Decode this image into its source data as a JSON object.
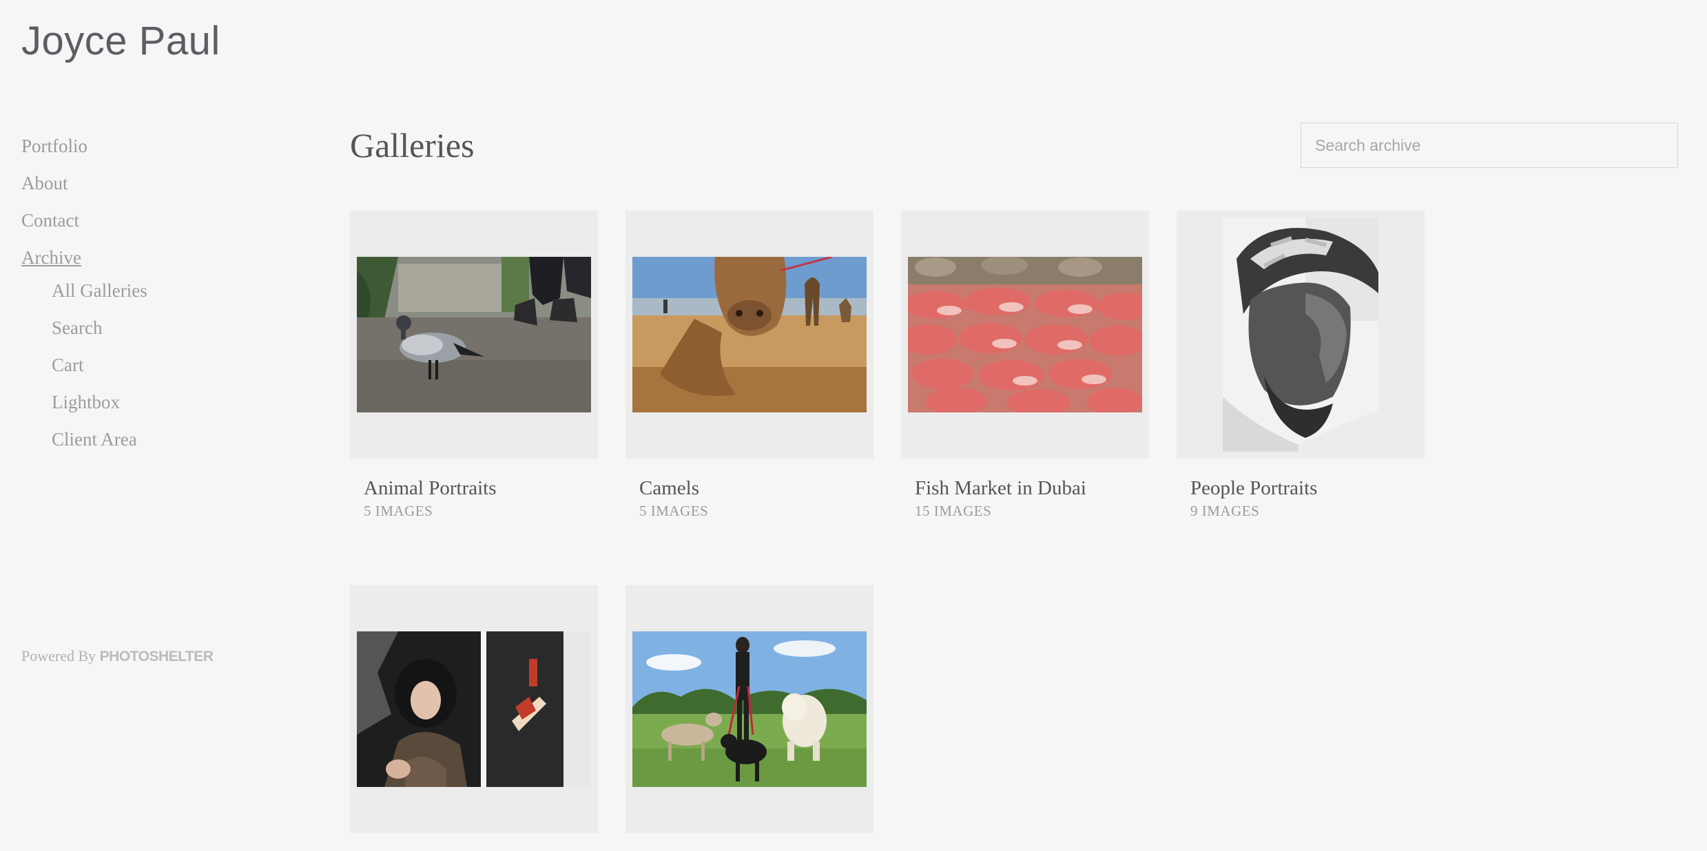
{
  "site": {
    "title": "Joyce Paul"
  },
  "nav": {
    "items": [
      {
        "label": "Portfolio"
      },
      {
        "label": "About"
      },
      {
        "label": "Contact"
      },
      {
        "label": "Archive"
      }
    ],
    "subitems": [
      {
        "label": "All Galleries"
      },
      {
        "label": "Search"
      },
      {
        "label": "Cart"
      },
      {
        "label": "Lightbox"
      },
      {
        "label": "Client Area"
      }
    ]
  },
  "footer": {
    "powered_by": "Powered By",
    "brand": "PHOTOSHELTER"
  },
  "main": {
    "heading": "Galleries",
    "search": {
      "placeholder": "Search archive",
      "value": ""
    }
  },
  "galleries": [
    {
      "title": "Animal Portraits",
      "count": "5 IMAGES"
    },
    {
      "title": "Camels",
      "count": "5 IMAGES"
    },
    {
      "title": "Fish Market in Dubai",
      "count": "15 IMAGES"
    },
    {
      "title": "People Portraits",
      "count": "9 IMAGES"
    },
    {
      "title": "",
      "count": ""
    },
    {
      "title": "",
      "count": ""
    }
  ],
  "colors": {
    "background": "#f6f6f6",
    "text": "#555555",
    "muted": "#9c9c9c"
  }
}
